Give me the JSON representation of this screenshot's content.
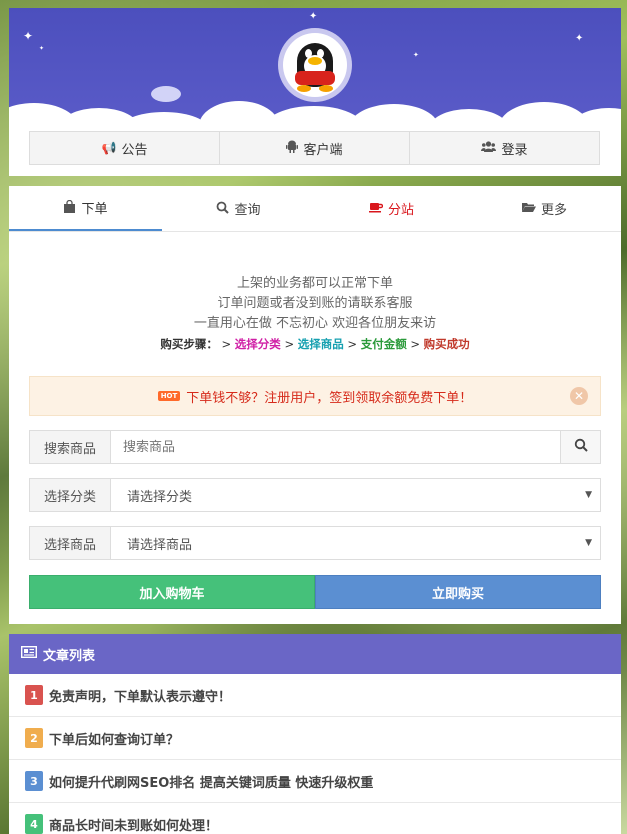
{
  "header": {
    "nav": [
      {
        "icon": "megaphone-icon",
        "label": "公告"
      },
      {
        "icon": "android-icon",
        "label": "客户端"
      },
      {
        "icon": "users-icon",
        "label": "登录"
      }
    ]
  },
  "tabs": [
    {
      "icon": "shopping-bag-icon",
      "label": "下单",
      "active": true
    },
    {
      "icon": "search-icon",
      "label": "查询"
    },
    {
      "icon": "coffee-icon",
      "label": "分站",
      "color": "#d9161c"
    },
    {
      "icon": "folder-open-icon",
      "label": "更多"
    }
  ],
  "notice": {
    "line1": "上架的业务都可以正常下单",
    "line2": "订单问题或者没到账的请联系客服",
    "line3": "一直用心在做 不忘初心 欢迎各位朋友来访"
  },
  "steps": {
    "prefix": "购买步骤：",
    "s1": "选择分类",
    "s2": "选择商品",
    "s3": "支付金额",
    "s4": "购买成功"
  },
  "alert": {
    "badge": "HOT",
    "text": "下单钱不够？注册用户，签到领取余额免费下单！"
  },
  "form": {
    "search_label": "搜索商品",
    "search_placeholder": "搜索商品",
    "category_label": "选择分类",
    "category_value": "请选择分类",
    "product_label": "选择商品",
    "product_value": "请选择商品"
  },
  "buttons": {
    "cart": "加入购物车",
    "buy": "立即购买"
  },
  "articles": {
    "title": "文章列表",
    "items": [
      {
        "num": "1",
        "color": "#d9534f",
        "title": "免责声明，下单默认表示遵守！"
      },
      {
        "num": "2",
        "color": "#f0ad4e",
        "title": "下单后如何查询订单？"
      },
      {
        "num": "3",
        "color": "#5b8fd2",
        "title": "如何提升代刷网SEO排名 提高关键词质量 快速升级权重"
      },
      {
        "num": "4",
        "color": "#45c17a",
        "title": "商品长时间未到账如何处理！"
      }
    ]
  },
  "colors": {
    "header_sky": "#4c4fbd",
    "accent_green": "#45c17a",
    "accent_blue": "#5b8fd2",
    "article_header": "#6a66c6",
    "alert_text": "#d62b1b"
  }
}
